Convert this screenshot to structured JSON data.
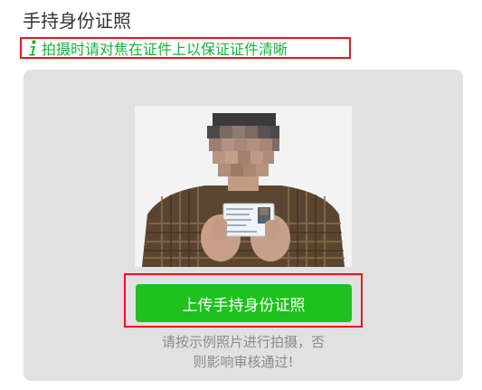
{
  "page": {
    "title": "手持身份证照"
  },
  "hint": {
    "icon": "info-icon",
    "text": "拍摄时请对焦在证件上以保证证件清晰"
  },
  "sample": {
    "image": "example-photo-person-holding-id-card"
  },
  "upload": {
    "button_label": "上传手持身份证照"
  },
  "caption": {
    "line1": "请按示例照片进行拍摄，否",
    "line2": "则影响审核通过!"
  },
  "colors": {
    "accent_green": "#1ec11e",
    "hint_green": "#1ab23c",
    "highlight_red": "#e8141b",
    "card_bg": "#e1e1e1"
  }
}
